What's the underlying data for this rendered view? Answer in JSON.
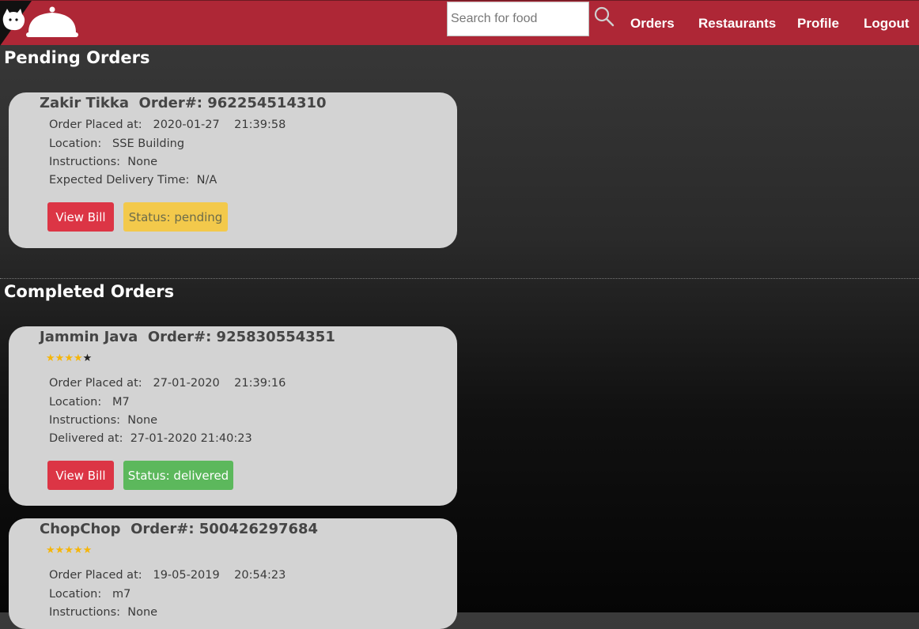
{
  "search": {
    "placeholder": "Search for food"
  },
  "nav": {
    "orders": "Orders",
    "restaurants": "Restaurants",
    "profile": "Profile",
    "logout": "Logout"
  },
  "sections": {
    "pending": "Pending Orders",
    "completed": "Completed Orders"
  },
  "pending_order": {
    "restaurant": "Zakir Tikka",
    "order_label": "Order#:",
    "order_number": "962254514310",
    "title": "Zakir Tikka  Order#: 962254514310",
    "placed": "Order Placed at:   2020-01-27    21:39:58",
    "location": "Location:   SSE Building",
    "instructions": "Instructions:  None",
    "expected": "Expected Delivery Time:  N/A",
    "view_bill": "View Bill",
    "status": "Status: pending"
  },
  "completed_orders": [
    {
      "title": "Jammin Java  Order#: 925830554351",
      "rating": 4,
      "rating_max": 5,
      "placed": "Order Placed at:   27-01-2020    21:39:16",
      "location": "Location:   M7",
      "instructions": "Instructions:  None",
      "delivered": "Delivered at:  27-01-2020 21:40:23",
      "view_bill": "View Bill",
      "status": "Status: delivered"
    },
    {
      "title": "ChopChop  Order#: 500426297684",
      "rating": 5,
      "rating_max": 5,
      "placed": "Order Placed at:   19-05-2019    20:54:23",
      "location": "Location:   m7",
      "instructions": "Instructions:  None"
    }
  ],
  "colors": {
    "navbar": "#ae2736",
    "card": "#d3d3d3",
    "view_bill": "#dc3545",
    "pending": "#f3c94b",
    "delivered": "#5cb85c",
    "star": "#f5b50a"
  },
  "icons": {
    "logo": "cat-cloche-logo",
    "search": "search-icon"
  }
}
